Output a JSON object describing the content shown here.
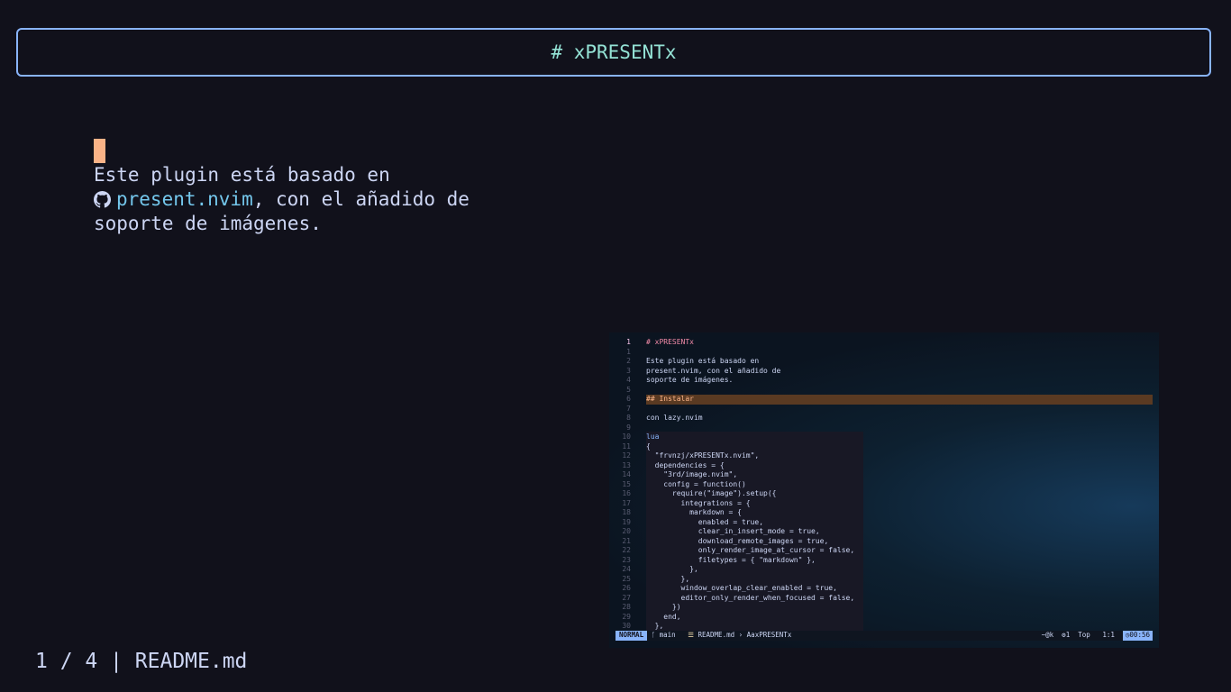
{
  "slide": {
    "title": "# xPRESENTx",
    "intro_lines": [
      "Este plugin está basado en",
      ", con el añadido de",
      "soporte de imágenes."
    ],
    "link_text": "present.nvim",
    "footer": "1 / 4 | README.md"
  },
  "screenshot": {
    "line_numbers": [
      "1",
      "1",
      "2",
      "3",
      "4",
      "5",
      "6",
      "7",
      "8",
      "9",
      "10",
      "11",
      "12",
      "13",
      "14",
      "15",
      "16",
      "17",
      "18",
      "19",
      "20",
      "21",
      "22",
      "23",
      "24",
      "25",
      "26",
      "27",
      "28",
      "29",
      "30"
    ],
    "lines": [
      "# xPRESENTx",
      "",
      "Este plugin está basado en",
      "present.nvim, con el añadido de",
      "soporte de imágenes.",
      "",
      "## Instalar",
      "",
      "con lazy.nvim",
      "",
      "lua",
      "{",
      "  \"frvnzj/xPRESENTx.nvim\",",
      "  dependencies = {",
      "    \"3rd/image.nvim\",",
      "    config = function()",
      "      require(\"image\").setup({",
      "        integrations = {",
      "          markdown = {",
      "            enabled = true,",
      "            clear_in_insert_mode = true,",
      "            download_remote_images = true,",
      "            only_render_image_at_cursor = false,",
      "            filetypes = { \"markdown\" },",
      "          },",
      "        },",
      "        window_overlap_clear_enabled = true,",
      "        editor_only_render_when_focused = false,",
      "      })",
      "    end,",
      "  },"
    ],
    "status": {
      "mode": "NORMAL",
      "branch": "main",
      "file": "README.md",
      "symbol": "AaxPRESENTx",
      "keys": "~@k",
      "count": "1",
      "position": "Top",
      "cursor": "1:1",
      "time": "00:56"
    }
  }
}
